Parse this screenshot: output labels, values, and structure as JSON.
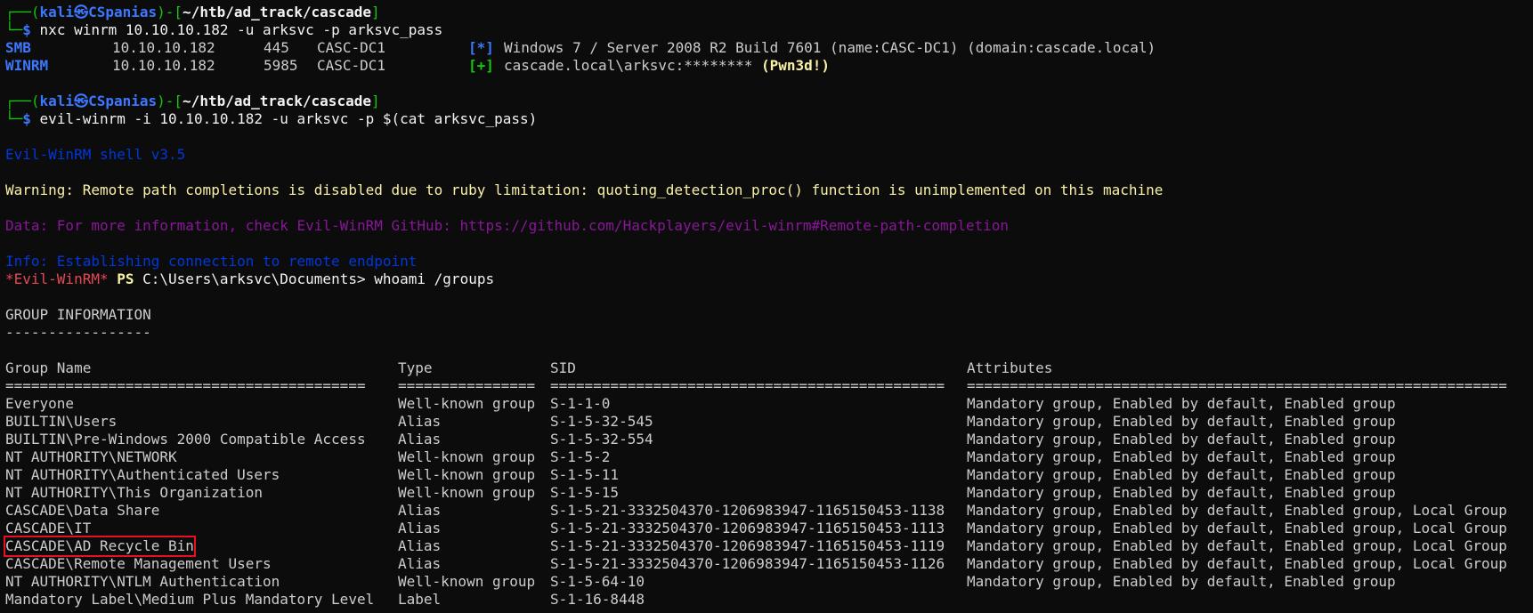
{
  "prompt": {
    "user": "kali",
    "host": "CSpanias",
    "path": "~/htb/ad_track/cascade",
    "skull": "㉿",
    "dollar": "$"
  },
  "cmd1": "nxc winrm 10.10.10.182 -u arksvc -p arksvc_pass",
  "nxc": [
    {
      "proto": "SMB",
      "ip": "10.10.10.182",
      "port": "445",
      "name": "CASC-DC1",
      "tag": "[*]",
      "msg": "Windows 7 / Server 2008 R2 Build 7601 (name:CASC-DC1) (domain:cascade.local)",
      "extra": ""
    },
    {
      "proto": "WINRM",
      "ip": "10.10.10.182",
      "port": "5985",
      "name": "CASC-DC1",
      "tag": "[+]",
      "msg": "cascade.local\\arksvc:******** ",
      "extra": "(Pwn3d!)"
    }
  ],
  "cmd2": "evil-winrm -i 10.10.10.182 -u arksvc -p $(cat arksvc_pass)",
  "banner": "Evil-WinRM shell v3.5",
  "warning": "Warning: Remote path completions is disabled due to ruby limitation: quoting_detection_proc() function is unimplemented on this machine",
  "data_line": "Data: For more information, check Evil-WinRM GitHub: https://github.com/Hackplayers/evil-winrm#Remote-path-completion",
  "info": "Info: Establishing connection to remote endpoint",
  "ps_prompt": {
    "star": "*Evil-WinRM*",
    "ps": "PS",
    "path": "C:\\Users\\arksvc\\Documents>",
    "cmd": "whoami /groups"
  },
  "group_info_title": "GROUP INFORMATION",
  "group_info_rule": "-----------------",
  "headers": {
    "name": "Group Name",
    "type": "Type",
    "sid": "SID",
    "attr": "Attributes"
  },
  "header_rules": {
    "name": "==========================================",
    "type": "================",
    "sid": "==============================================",
    "attr": "==============================================================="
  },
  "rows": [
    {
      "name": "Everyone",
      "type": "Well-known group",
      "sid": "S-1-1-0",
      "attr": "Mandatory group, Enabled by default, Enabled group"
    },
    {
      "name": "BUILTIN\\Users",
      "type": "Alias",
      "sid": "S-1-5-32-545",
      "attr": "Mandatory group, Enabled by default, Enabled group"
    },
    {
      "name": "BUILTIN\\Pre-Windows 2000 Compatible Access",
      "type": "Alias",
      "sid": "S-1-5-32-554",
      "attr": "Mandatory group, Enabled by default, Enabled group"
    },
    {
      "name": "NT AUTHORITY\\NETWORK",
      "type": "Well-known group",
      "sid": "S-1-5-2",
      "attr": "Mandatory group, Enabled by default, Enabled group"
    },
    {
      "name": "NT AUTHORITY\\Authenticated Users",
      "type": "Well-known group",
      "sid": "S-1-5-11",
      "attr": "Mandatory group, Enabled by default, Enabled group"
    },
    {
      "name": "NT AUTHORITY\\This Organization",
      "type": "Well-known group",
      "sid": "S-1-5-15",
      "attr": "Mandatory group, Enabled by default, Enabled group"
    },
    {
      "name": "CASCADE\\Data Share",
      "type": "Alias",
      "sid": "S-1-5-21-3332504370-1206983947-1165150453-1138",
      "attr": "Mandatory group, Enabled by default, Enabled group, Local Group"
    },
    {
      "name": "CASCADE\\IT",
      "type": "Alias",
      "sid": "S-1-5-21-3332504370-1206983947-1165150453-1113",
      "attr": "Mandatory group, Enabled by default, Enabled group, Local Group"
    },
    {
      "name": "CASCADE\\AD Recycle Bin",
      "type": "Alias",
      "sid": "S-1-5-21-3332504370-1206983947-1165150453-1119",
      "attr": "Mandatory group, Enabled by default, Enabled group, Local Group"
    },
    {
      "name": "CASCADE\\Remote Management Users",
      "type": "Alias",
      "sid": "S-1-5-21-3332504370-1206983947-1165150453-1126",
      "attr": "Mandatory group, Enabled by default, Enabled group, Local Group"
    },
    {
      "name": "NT AUTHORITY\\NTLM Authentication",
      "type": "Well-known group",
      "sid": "S-1-5-64-10",
      "attr": "Mandatory group, Enabled by default, Enabled group"
    },
    {
      "name": "Mandatory Label\\Medium Plus Mandatory Level",
      "type": "Label",
      "sid": "S-1-16-8448",
      "attr": ""
    }
  ],
  "highlighted_row_index": 8
}
